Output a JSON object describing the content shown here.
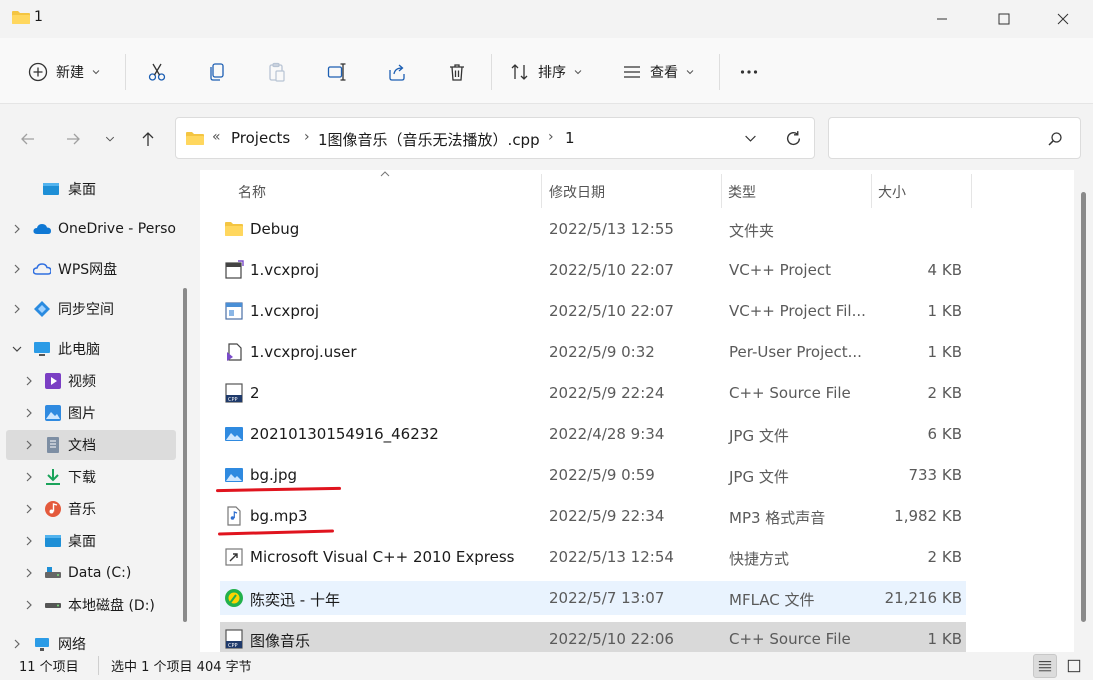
{
  "window": {
    "title": "1"
  },
  "toolbar": {
    "new_label": "新建",
    "sort_label": "排序",
    "view_label": "查看"
  },
  "address": {
    "prefix": "«",
    "crumbs": [
      "Projects",
      "1图像音乐（音乐无法播放）.cpp",
      "1"
    ],
    "search_placeholder": ""
  },
  "sidebar": {
    "items": [
      {
        "label": "桌面",
        "icon": "desktop-icon"
      },
      {
        "label": "OneDrive - Perso",
        "icon": "onedrive-icon"
      },
      {
        "label": "WPS网盘",
        "icon": "wps-cloud-icon"
      },
      {
        "label": "同步空间",
        "icon": "sync-space-icon"
      },
      {
        "label": "此电脑",
        "icon": "this-pc-icon"
      },
      {
        "label": "视频",
        "icon": "videos-icon"
      },
      {
        "label": "图片",
        "icon": "pictures-icon"
      },
      {
        "label": "文档",
        "icon": "documents-icon"
      },
      {
        "label": "下载",
        "icon": "downloads-icon"
      },
      {
        "label": "音乐",
        "icon": "music-icon"
      },
      {
        "label": "桌面",
        "icon": "desktop-icon"
      },
      {
        "label": "Data (C:)",
        "icon": "drive-icon"
      },
      {
        "label": "本地磁盘 (D:)",
        "icon": "drive-icon"
      },
      {
        "label": "网络",
        "icon": "network-icon"
      }
    ]
  },
  "columns": {
    "name": "名称",
    "date": "修改日期",
    "type": "类型",
    "size": "大小"
  },
  "files": [
    {
      "name": "Debug",
      "date": "2022/5/13 12:55",
      "type": "文件夹",
      "size": "",
      "icon": "folder-icon"
    },
    {
      "name": "1.vcxproj",
      "date": "2022/5/10 22:07",
      "type": "VC++ Project",
      "size": "4 KB",
      "icon": "vcxproj-icon"
    },
    {
      "name": "1.vcxproj",
      "date": "2022/5/10 22:07",
      "type": "VC++ Project Fil...",
      "size": "1 KB",
      "icon": "vcxproj-filters-icon"
    },
    {
      "name": "1.vcxproj.user",
      "date": "2022/5/9 0:32",
      "type": "Per-User Project...",
      "size": "1 KB",
      "icon": "vs-user-icon"
    },
    {
      "name": "2",
      "date": "2022/5/9 22:24",
      "type": "C++ Source File",
      "size": "2 KB",
      "icon": "cpp-file-icon"
    },
    {
      "name": "20210130154916_46232",
      "date": "2022/4/28 9:34",
      "type": "JPG 文件",
      "size": "6 KB",
      "icon": "image-file-icon"
    },
    {
      "name": "bg.jpg",
      "date": "2022/5/9 0:59",
      "type": "JPG 文件",
      "size": "733 KB",
      "icon": "image-file-icon"
    },
    {
      "name": "bg.mp3",
      "date": "2022/5/9 22:34",
      "type": "MP3 格式声音",
      "size": "1,982 KB",
      "icon": "mp3-file-icon"
    },
    {
      "name": "Microsoft Visual C++ 2010 Express",
      "date": "2022/5/13 12:54",
      "type": "快捷方式",
      "size": "2 KB",
      "icon": "shortcut-icon"
    },
    {
      "name": "陈奕迅 - 十年",
      "date": "2022/5/7 13:07",
      "type": "MFLAC 文件",
      "size": "21,216 KB",
      "icon": "mflac-file-icon"
    },
    {
      "name": "图像音乐",
      "date": "2022/5/10 22:06",
      "type": "C++ Source File",
      "size": "1 KB",
      "icon": "cpp-file-icon"
    }
  ],
  "status": {
    "count": "11 个项目",
    "selection": "选中 1 个项目  404 字节"
  },
  "colors": {
    "accent": "#0067c0",
    "hover_row": "#e9f3fe",
    "selected_row": "#d9d9d9",
    "annotation_red": "#e0141e"
  }
}
